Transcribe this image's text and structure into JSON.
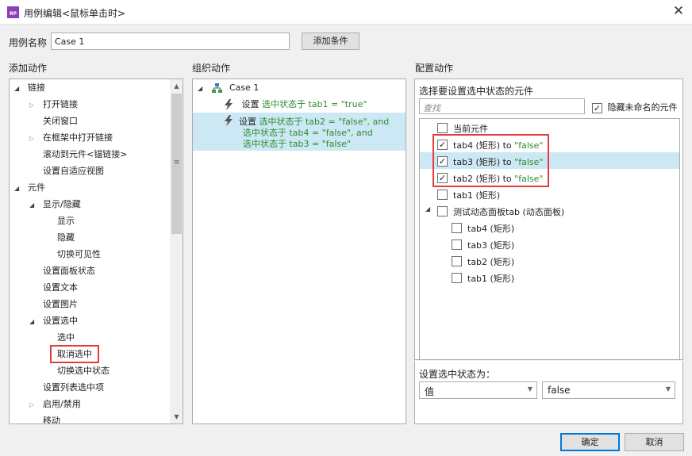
{
  "window": {
    "title": "用例编辑<鼠标单击时>",
    "app_icon_text": "RP"
  },
  "name_row": {
    "label": "用例名称",
    "value": "Case 1",
    "add_condition_label": "添加条件"
  },
  "left": {
    "header": "添加动作",
    "items": [
      {
        "label": "链接"
      },
      {
        "label": "打开链接"
      },
      {
        "label": "关闭窗口"
      },
      {
        "label": "在框架中打开链接"
      },
      {
        "label": "滚动到元件<锚链接>"
      },
      {
        "label": "设置自适应视图"
      },
      {
        "label": "元件"
      },
      {
        "label": "显示/隐藏"
      },
      {
        "label": "显示"
      },
      {
        "label": "隐藏"
      },
      {
        "label": "切换可见性"
      },
      {
        "label": "设置面板状态"
      },
      {
        "label": "设置文本"
      },
      {
        "label": "设置图片"
      },
      {
        "label": "设置选中"
      },
      {
        "label": "选中"
      },
      {
        "label": "取消选中"
      },
      {
        "label": "切换选中状态"
      },
      {
        "label": "设置列表选中项"
      },
      {
        "label": "启用/禁用"
      },
      {
        "label": "移动"
      }
    ]
  },
  "middle": {
    "header": "组织动作",
    "case_label": "Case 1",
    "action1": {
      "prefix": "设置",
      "text": "选中状态于 tab1 = \"true\""
    },
    "action2": {
      "prefix": "设置",
      "line1": "选中状态于 tab2 = \"false\", and",
      "line2": "选中状态于 tab4 = \"false\", and",
      "line3": "选中状态于 tab3 = \"false\""
    }
  },
  "right": {
    "header": "配置动作",
    "sub_header": "选择要设置选中状态的元件",
    "search_placeholder": "查找",
    "hide_unnamed_label": "隐藏未命名的元件",
    "hide_unnamed_checked": true,
    "widgets": [
      {
        "name": "当前元件",
        "suffix": "",
        "checked": false
      },
      {
        "name": "tab4 (矩形) to ",
        "suffix": "\"false\"",
        "checked": true
      },
      {
        "name": "tab3 (矩形) to ",
        "suffix": "\"false\"",
        "checked": true
      },
      {
        "name": "tab2 (矩形) to ",
        "suffix": "\"false\"",
        "checked": true
      },
      {
        "name": "tab1 (矩形)",
        "suffix": "",
        "checked": false
      },
      {
        "name": "测试动态面板tab (动态面板)",
        "suffix": "",
        "checked": false
      },
      {
        "name": "tab4 (矩形)",
        "suffix": "",
        "checked": false
      },
      {
        "name": "tab3 (矩形)",
        "suffix": "",
        "checked": false
      },
      {
        "name": "tab2 (矩形)",
        "suffix": "",
        "checked": false
      },
      {
        "name": "tab1 (矩形)",
        "suffix": "",
        "checked": false
      }
    ],
    "state_label": "设置选中状态为：",
    "state_type": "值",
    "state_value": "false"
  },
  "footer": {
    "ok_label": "确定",
    "cancel_label": "取消"
  },
  "colors": {
    "highlight": "#cce8f4",
    "green_text": "#2e8b2e",
    "red_box": "#e33c3c",
    "app_icon": "#8e3fb8",
    "primary_border": "#0078d7"
  }
}
